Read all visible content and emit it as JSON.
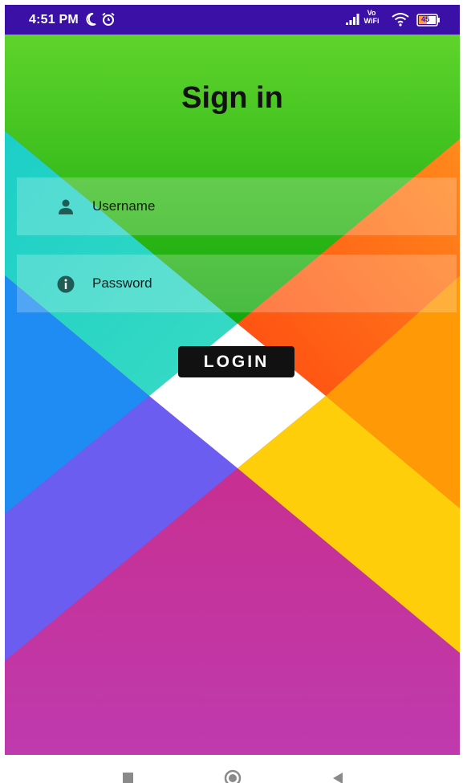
{
  "status_bar": {
    "time": "4:51 PM",
    "network_label": "Vo WiFi",
    "battery": "45",
    "background_color": "#3a10a6"
  },
  "main": {
    "title": "Sign in",
    "username": {
      "placeholder": "Username",
      "icon": "person-icon"
    },
    "password": {
      "placeholder": "Password",
      "icon": "info-icon"
    },
    "login_label": "LOGIN"
  },
  "colors": {
    "top_green": "#2fb51c",
    "teal": "#2fd6c5",
    "orange": "#ff6d1a",
    "blue": "#1f8cf3",
    "purple": "#6a5df0",
    "yellow": "#ffce0a",
    "magenta": "#c82d80",
    "button": "#111111"
  },
  "nav_bar": {
    "icons": [
      "recents-icon",
      "home-icon",
      "back-icon"
    ]
  }
}
